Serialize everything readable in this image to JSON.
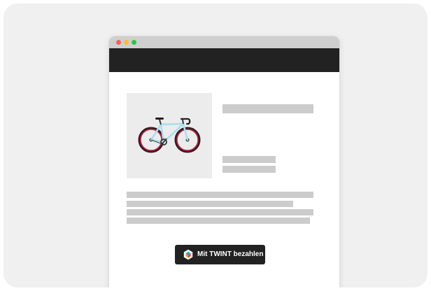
{
  "browser": {
    "traffic_lights": [
      {
        "name": "close",
        "color": "#ff5f57"
      },
      {
        "name": "minimize",
        "color": "#febc2e"
      },
      {
        "name": "maximize",
        "color": "#28c840"
      }
    ],
    "navbar_color": "#222222"
  },
  "product": {
    "image_icon": "bicycle-icon"
  },
  "payment": {
    "button_label": "Mit TWINT bezahlen",
    "icon": "twint-icon",
    "button_color": "#222222"
  }
}
